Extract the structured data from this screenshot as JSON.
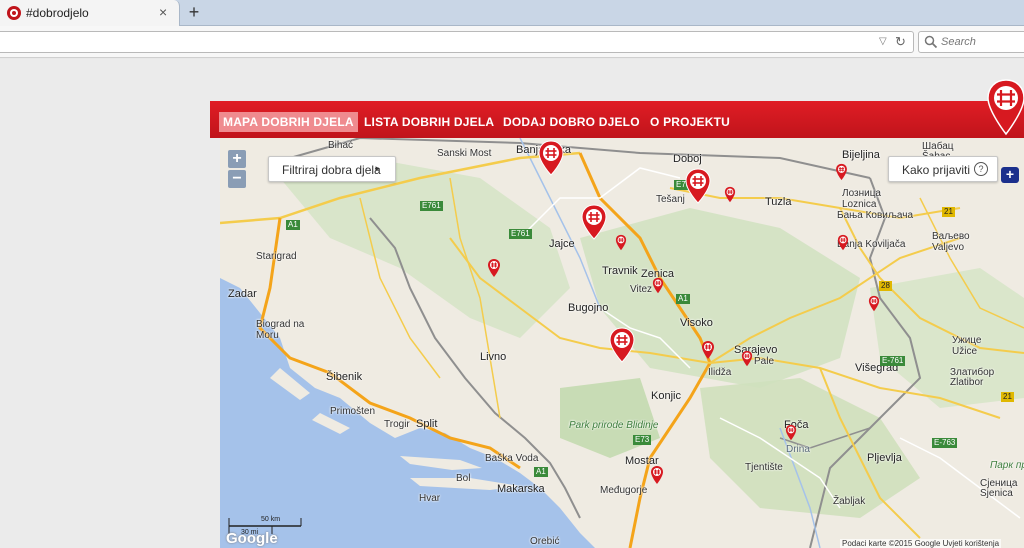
{
  "browser": {
    "tab_title": "#dobrodjelo",
    "tab_close": "×",
    "new_tab": "+",
    "url_value": "",
    "search_placeholder": "Search"
  },
  "header": {
    "nav": [
      "MAPA DOBRIH DJELA",
      "LISTA DOBRIH DJELA",
      "DODAJ DOBRO DJELO",
      "O PROJEKTU"
    ],
    "active_index": 0,
    "brand_color": "#d71920"
  },
  "map": {
    "filter_label": "Filtriraj dobra djela",
    "help_label": "Kako prijaviti",
    "help_icon": "?",
    "zoom_in": "+",
    "zoom_out": "−",
    "plus_badge": "+",
    "scale_km": "50 km",
    "scale_mi": "30 mi",
    "google_logo": "Google",
    "attribution": "Podaci karte ©2015 Google    Uvjeti korištenja",
    "places": [
      "Bihać",
      "Sanski Most",
      "Banja Luka",
      "Doboj",
      "Bijeljina",
      "Шабац",
      "Šabac",
      "Lozница",
      "Лозница",
      "Loznica",
      "Бања Ковиљача",
      "Banja Koviljača",
      "Ваљево",
      "Valjevo",
      "Tešanj",
      "Tuzla",
      "Jajce",
      "Travnik",
      "Zenica",
      "Vitez",
      "Bugojno",
      "Visoko",
      "Sarajevo",
      "Pale",
      "Ilidža",
      "Livno",
      "Konjic",
      "Park prirode Blidinje",
      "Mostar",
      "Međugorje",
      "Višegrad",
      "Ужице",
      "Užice",
      "Златибор",
      "Zlatibor",
      "Foča",
      "Drina",
      "Tjentište",
      "Pljevlja",
      "Парк природе Златибор",
      "Žabljak",
      "Сјеница",
      "Sjenica",
      "Zadar",
      "Starigrad",
      "Biograd na Moru",
      "Šibenik",
      "Primošten",
      "Trogir",
      "Split",
      "Baška Voda",
      "Makarska",
      "Bol",
      "Hvar",
      "Orebić"
    ],
    "roads": [
      "A1",
      "E761",
      "E761",
      "E73",
      "A1",
      "E73",
      "A1",
      "E-761",
      "E-763",
      "21",
      "21",
      "28",
      "A1",
      "28"
    ]
  }
}
